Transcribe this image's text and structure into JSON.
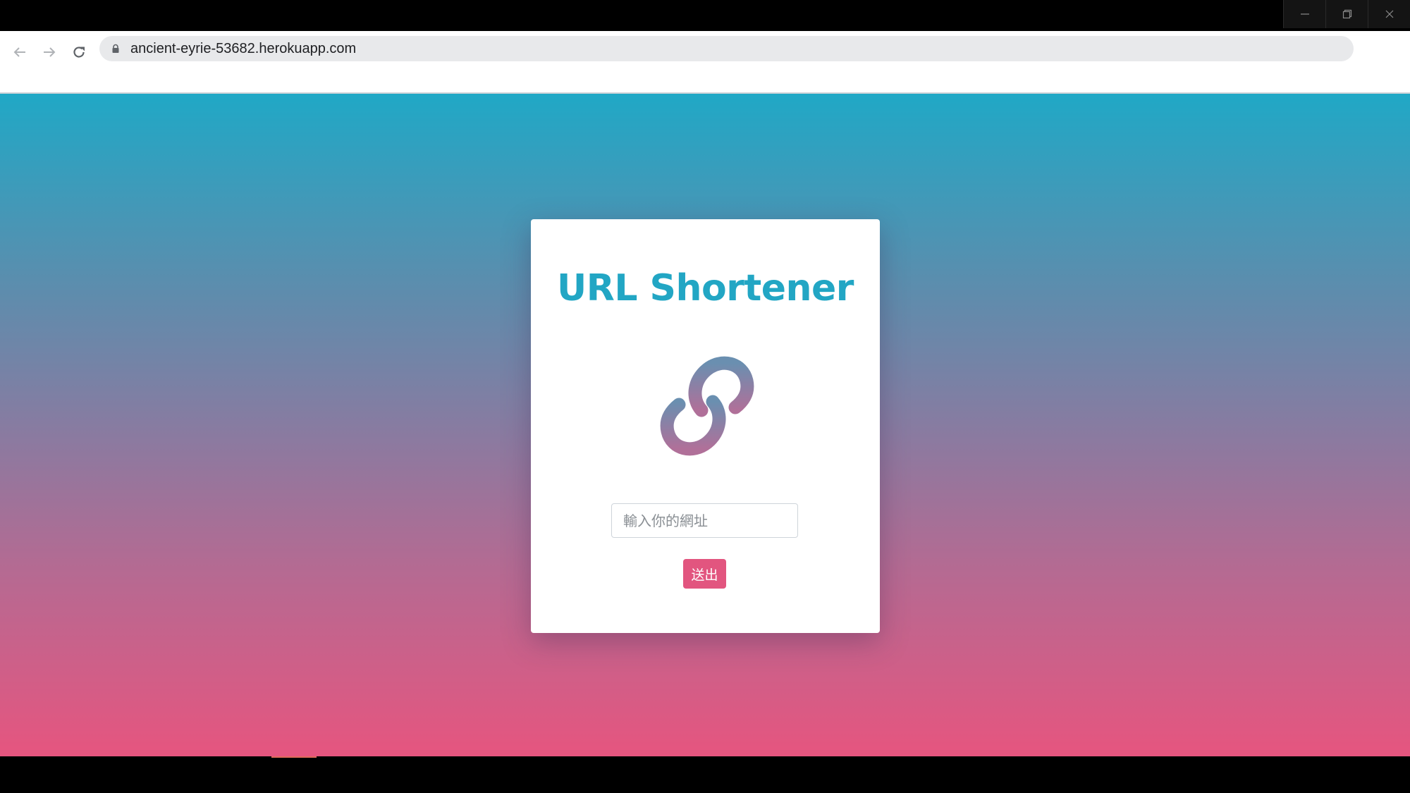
{
  "browser": {
    "address_bar": {
      "url": "ancient-eyrie-53682.herokuapp.com"
    },
    "window_controls": [
      "minimize-icon",
      "restore-icon",
      "close-icon"
    ],
    "nav_icons": [
      "back-arrow-icon",
      "forward-arrow-icon",
      "reload-icon",
      "lock-icon"
    ]
  },
  "page": {
    "title": "URL Shortener",
    "logo_icon": "link-icon",
    "input": {
      "placeholder": "輸入你的網址",
      "value": ""
    },
    "submit_label": "送出"
  },
  "colors": {
    "gradient_top": "#20a8c6",
    "gradient_bottom": "#e6557f",
    "title": "#22a6c4",
    "button": "#e2557f",
    "logo_top": "#6a8fb0",
    "logo_bottom": "#b07099"
  }
}
